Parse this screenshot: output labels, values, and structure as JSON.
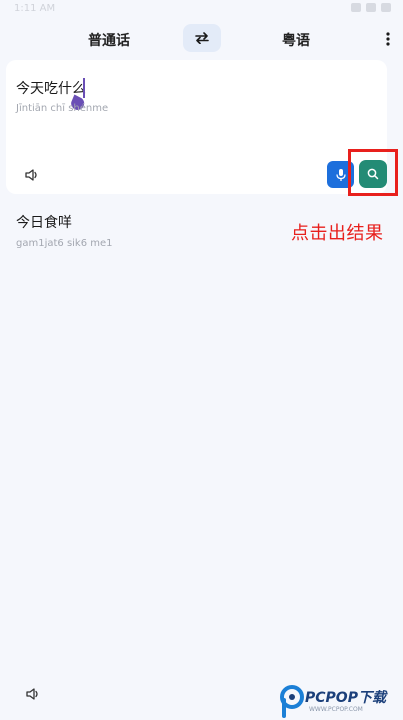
{
  "status_bar": {
    "time": "1:11 AM"
  },
  "top_bar": {
    "source_language": "普通话",
    "target_language": "粤语"
  },
  "input": {
    "text": "今天吃什么",
    "pinyin": "Jīntiān chī shénme"
  },
  "result": {
    "text": "今日食咩",
    "jyutping": "gam1jat6 sik6 me1"
  },
  "annotation": {
    "text": "点击出结果"
  },
  "watermark": {
    "brand": "PCPOP下载",
    "sub": "WWW.PCPOP.COM"
  },
  "colors": {
    "accent_blue": "#1d6fdc",
    "search_green": "#238b75",
    "highlight_red": "#e8201d",
    "swap_bg": "#e3ebf8"
  }
}
